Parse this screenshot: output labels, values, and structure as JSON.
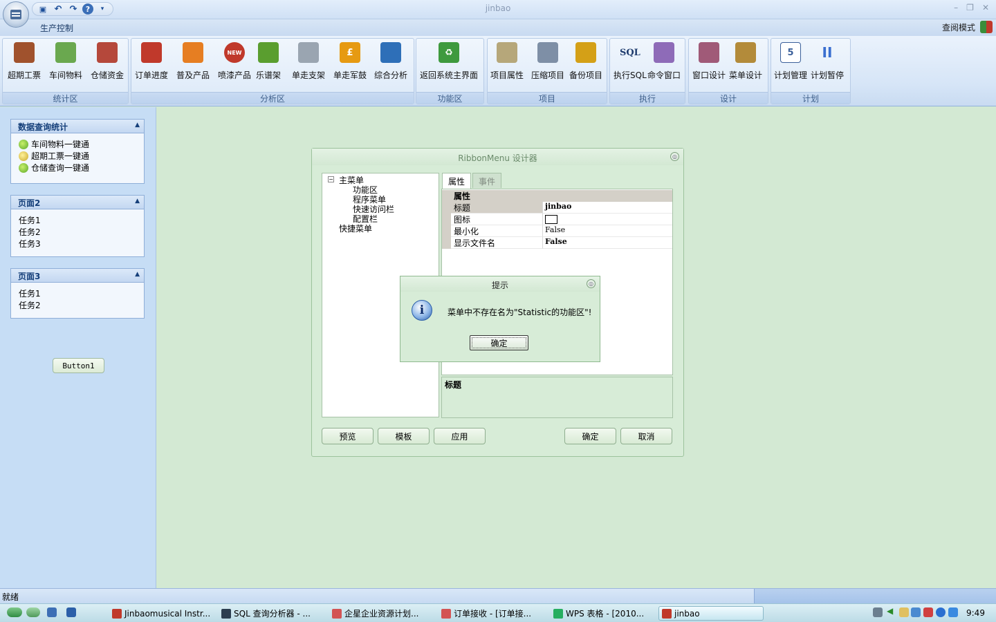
{
  "window": {
    "title": "jinbao",
    "minimize": "–",
    "restore": "❐",
    "close": "✕"
  },
  "qat": {
    "save": "💾",
    "undo": "↶",
    "redo": "↷",
    "help": "?",
    "more": "▾"
  },
  "tab": {
    "label": "生产控制"
  },
  "mode": {
    "label": "查阅模式"
  },
  "ribbon": {
    "groups": [
      {
        "label": "统计区",
        "buttons": [
          {
            "label": "超期工票",
            "icon": "book-icon",
            "color": "#a0522d"
          },
          {
            "label": "车间物料",
            "icon": "cart-icon",
            "color": "#6aa84f"
          },
          {
            "label": "仓储资金",
            "icon": "house-icon",
            "color": "#b5483b"
          }
        ]
      },
      {
        "label": "分析区",
        "buttons": [
          {
            "label": "订单进度",
            "icon": "calculator-icon",
            "color": "#c0392b"
          },
          {
            "label": "普及产品",
            "icon": "lifebuoy-icon",
            "color": "#e67e22"
          },
          {
            "label": "喷漆产品",
            "icon": "new-badge-icon",
            "color": "#c0392b",
            "glyph": "NEW"
          },
          {
            "label": "乐谱架",
            "icon": "disc-icon",
            "color": "#5a9e2f"
          },
          {
            "label": "单走支架",
            "icon": "link-icon",
            "color": "#9aa5b1"
          },
          {
            "label": "单走军鼓",
            "icon": "pound-icon",
            "color": "#e69a12",
            "glyph": "£"
          },
          {
            "label": "综合分析",
            "icon": "user-icon",
            "color": "#2e6fb8"
          }
        ]
      },
      {
        "label": "功能区",
        "buttons": [
          {
            "label": "返回系统主界面",
            "icon": "recycle-icon",
            "color": "#3e9a3e",
            "glyph": "♻"
          }
        ]
      },
      {
        "label": "项目",
        "buttons": [
          {
            "label": "项目属性",
            "icon": "document-icon",
            "color": "#b6a77a"
          },
          {
            "label": "压缩项目",
            "icon": "compress-icon",
            "color": "#7e8fa6"
          },
          {
            "label": "备份项目",
            "icon": "backup-icon",
            "color": "#d4a017"
          }
        ]
      },
      {
        "label": "执行",
        "buttons": [
          {
            "label": "执行SQL",
            "icon": "sql-icon",
            "color": "#1f3c6e",
            "glyph": "SQL"
          },
          {
            "label": "命令窗口",
            "icon": "command-window-icon",
            "color": "#8e6bb8"
          }
        ]
      },
      {
        "label": "设计",
        "buttons": [
          {
            "label": "窗口设计",
            "icon": "window-design-icon",
            "color": "#a05a78"
          },
          {
            "label": "菜单设计",
            "icon": "menu-design-icon",
            "color": "#b38b3a"
          }
        ]
      },
      {
        "label": "计划",
        "buttons": [
          {
            "label": "计划管理",
            "icon": "calendar-icon",
            "color": "#3a5f9a",
            "glyph": "5"
          },
          {
            "label": "计划暂停",
            "icon": "pause-icon",
            "color": "#3a6fd0",
            "glyph": "II"
          }
        ]
      }
    ]
  },
  "left_panel": {
    "panels": [
      {
        "title": "数据查询统计",
        "items": [
          "车间物料一键通",
          "超期工票一键通",
          "仓储查询一键通"
        ]
      },
      {
        "title": "页面2",
        "items": [
          "任务1",
          "任务2",
          "任务3"
        ]
      },
      {
        "title": "页面3",
        "items": [
          "任务1",
          "任务2"
        ]
      }
    ],
    "button1": "Button1"
  },
  "designer": {
    "title": "RibbonMenu 设计器",
    "tree": {
      "root": "主菜单",
      "children": [
        "功能区",
        "程序菜单",
        "快速访问栏",
        "配置栏"
      ],
      "sibling": "快捷菜单"
    },
    "tabs": [
      "属性",
      "事件"
    ],
    "prop_category": "属性",
    "props": [
      {
        "name": "标题",
        "value": "jinbao"
      },
      {
        "name": "图标",
        "value": ""
      },
      {
        "name": "最小化",
        "value": "False"
      },
      {
        "name": "显示文件名",
        "value": "False"
      }
    ],
    "desc_title": "标题",
    "buttons": {
      "preview": "预览",
      "template": "模板",
      "apply": "应用",
      "ok": "确定",
      "cancel": "取消"
    }
  },
  "prompt": {
    "title": "提示",
    "message": "菜单中不存在名为\"Statistic的功能区\"!",
    "ok": "确定",
    "icon": "info-icon"
  },
  "statusbar": {
    "text": "就绪"
  },
  "taskbar": {
    "items": [
      {
        "label": "Jinbaomusical Instr...",
        "icon_color": "#c0392b"
      },
      {
        "label": "SQL 查询分析器 - ...",
        "icon_color": "#2c3e50"
      },
      {
        "label": "企星企业资源计划...",
        "icon_color": "#d35454"
      },
      {
        "label": "订单接收 - [订单接...",
        "icon_color": "#d35454"
      },
      {
        "label": "WPS 表格 - [2010...",
        "icon_color": "#27ae60"
      },
      {
        "label": "jinbao",
        "icon_color": "#c0392b"
      }
    ],
    "clock": "9:49"
  }
}
